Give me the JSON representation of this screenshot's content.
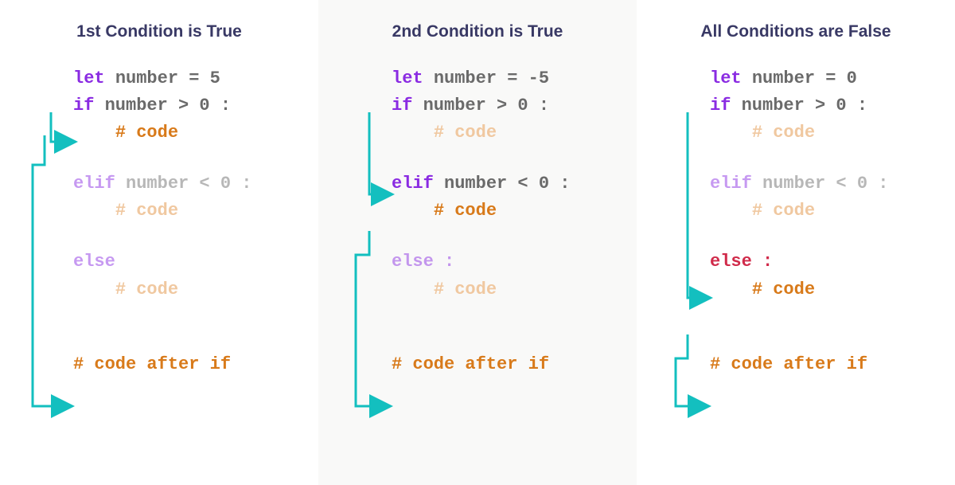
{
  "panels": [
    {
      "title": "1st Condition is True",
      "code": {
        "let": "let",
        "var": "number",
        "eq": "=",
        "val": "5",
        "if": "if",
        "cond1": "number > 0 :",
        "code1": "# code",
        "elif": "elif",
        "cond2": "number < 0 :",
        "code2": "# code",
        "else": "else",
        "elsecolon": "",
        "code3": "# code",
        "after": "# code after if"
      }
    },
    {
      "title": "2nd Condition is True",
      "code": {
        "let": "let",
        "var": "number",
        "eq": "=",
        "val": "-5",
        "if": "if",
        "cond1": "number > 0 :",
        "code1": "# code",
        "elif": "elif",
        "cond2": "number < 0 :",
        "code2": "# code",
        "else": "else :",
        "elsecolon": "",
        "code3": "# code",
        "after": "# code after if"
      }
    },
    {
      "title": "All Conditions are False",
      "code": {
        "let": "let",
        "var": "number",
        "eq": "=",
        "val": "0",
        "if": "if",
        "cond1": "number > 0 :",
        "code1": "# code",
        "elif": "elif",
        "cond2": "number < 0 :",
        "code2": "# code",
        "else": "else :",
        "elsecolon": "",
        "code3": "# code",
        "after": "# code after if"
      }
    }
  ],
  "colors": {
    "teal": "#13bfbf",
    "purple": "#8a2be2",
    "orange": "#d87a1a",
    "gray": "#6a6a6a",
    "heading": "#393965"
  },
  "chart_data": {
    "type": "table",
    "title": "if/elif/else control flow for three scenarios",
    "series": [
      {
        "name": "1st Condition is True",
        "number": 5,
        "branch_taken": "if",
        "condition": "number > 0"
      },
      {
        "name": "2nd Condition is True",
        "number": -5,
        "branch_taken": "elif",
        "condition": "number < 0"
      },
      {
        "name": "All Conditions are False",
        "number": 0,
        "branch_taken": "else",
        "condition": null
      }
    ]
  }
}
